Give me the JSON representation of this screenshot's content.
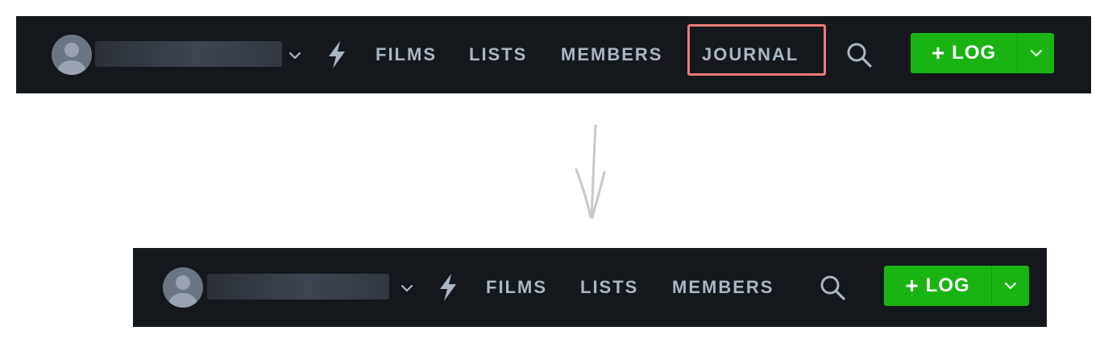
{
  "colors": {
    "navbar_bg": "#14181c",
    "nav_text": "#aab6c3",
    "log_green": "#19b413",
    "highlight_red": "#f07a7a",
    "arrow_gray": "#c8c8c8"
  },
  "before": {
    "nav_links": [
      "FILMS",
      "LISTS",
      "MEMBERS",
      "JOURNAL"
    ],
    "highlighted_link": "JOURNAL",
    "log_button": {
      "plus": "+",
      "label": "LOG"
    },
    "icons": [
      "avatar",
      "chevron-down-icon",
      "activity-bolt-icon",
      "search-icon",
      "chevron-down-icon"
    ]
  },
  "after": {
    "nav_links": [
      "FILMS",
      "LISTS",
      "MEMBERS"
    ],
    "log_button": {
      "plus": "+",
      "label": "LOG"
    },
    "icons": [
      "avatar",
      "chevron-down-icon",
      "activity-bolt-icon",
      "search-icon",
      "chevron-down-icon"
    ]
  },
  "transition_arrow": "down-arrow"
}
